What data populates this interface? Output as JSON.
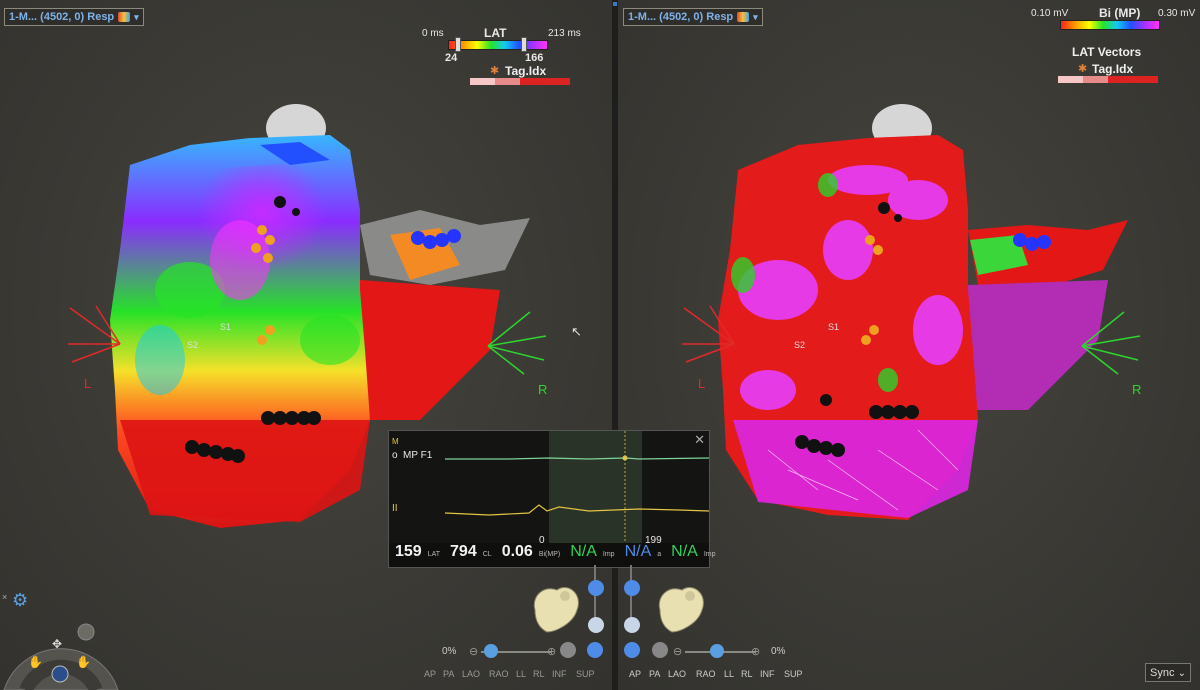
{
  "left_view": {
    "map_selector": "1-M... (4502, 0) Resp",
    "scale": {
      "title": "LAT",
      "min_label": "0 ms",
      "max_label": "213 ms",
      "low_value": "24",
      "high_value": "166"
    },
    "tag_label": "Tag.Idx",
    "orientation": {
      "left": "L",
      "right": "R"
    },
    "point_labels": [
      "S1",
      "S2"
    ],
    "zoom": "0%"
  },
  "right_view": {
    "map_selector": "1-M... (4502, 0) Resp",
    "scale": {
      "title": "Bi (MP)",
      "min_label": "0.10 mV",
      "max_label": "0.30 mV"
    },
    "vectors_label": "LAT Vectors",
    "tag_label": "Tag.Idx",
    "orientation": {
      "left": "L",
      "right": "R"
    },
    "point_labels": [
      "S1",
      "S2"
    ],
    "zoom": "0%"
  },
  "ecg_panel": {
    "channel_1": "MP F1",
    "channel_1_prefix": "o",
    "channel_1_marker": "M",
    "channel_2": "II",
    "window_start": "0",
    "window_end": "199",
    "lat_value": "159",
    "lat_unit": "LAT",
    "cl_value": "794",
    "cl_unit": "CL",
    "bi_value": "0.06",
    "bi_unit": "Bi(MP)",
    "na_1": "N/A",
    "na_1_unit": "Imp",
    "na_2": "N/A",
    "na_2_unit": "a",
    "na_3": "N/A",
    "na_3_unit": "Imp"
  },
  "view_buttons": [
    "AP",
    "PA",
    "LAO",
    "RAO",
    "LL",
    "RL",
    "INF",
    "SUP"
  ],
  "sync_label": "Sync",
  "colors": {
    "accent": "#7fb2ea",
    "na_green": "#2fd35a",
    "na_blue": "#4f8ce8",
    "trace_green": "#7ed49a",
    "trace_yellow": "#e3c445"
  }
}
